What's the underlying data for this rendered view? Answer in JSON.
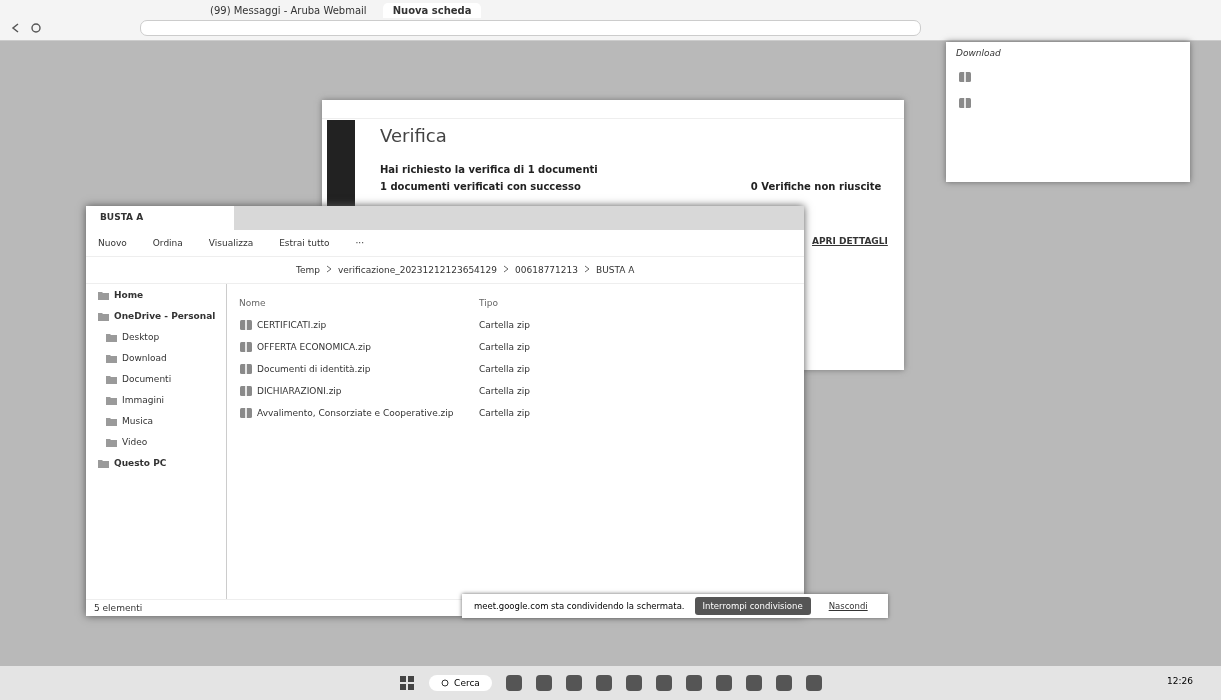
{
  "browser": {
    "tabs": [
      {
        "label": "(99) Messaggi - Aruba Webmail",
        "selected": false
      },
      {
        "label": "Nuova scheda",
        "selected": true
      }
    ]
  },
  "verifica": {
    "title": "Verifica",
    "heading": "Hai richiesto la verifica di 1 documenti",
    "success": "1 documenti verificati con successo",
    "failed": "0 Verifiche non riuscite",
    "details_button": "APRI DETTAGLI"
  },
  "explorer": {
    "tab": "BUSTA A",
    "toolbar": [
      "Nuovo",
      "Ordina",
      "Visualizza",
      "Estrai tutto",
      "···"
    ],
    "path": [
      "Temp",
      "verificazione_20231212123654129",
      "00618771213",
      "BUSTA A"
    ],
    "sidebar": [
      {
        "label": "Home",
        "kind": "top"
      },
      {
        "label": "OneDrive - Personal",
        "kind": "top"
      },
      {
        "label": "Desktop",
        "kind": "pin"
      },
      {
        "label": "Download",
        "kind": "pin"
      },
      {
        "label": "Documenti",
        "kind": "pin"
      },
      {
        "label": "Immagini",
        "kind": "pin"
      },
      {
        "label": "Musica",
        "kind": "pin"
      },
      {
        "label": "Video",
        "kind": "pin"
      },
      {
        "label": "Questo PC",
        "kind": "top"
      }
    ],
    "columns": [
      "Nome",
      "Tipo"
    ],
    "rows": [
      {
        "name": "CERTIFICATI.zip",
        "type": "Cartella zip"
      },
      {
        "name": "OFFERTA ECONOMICA.zip",
        "type": "Cartella zip"
      },
      {
        "name": "Documenti di identità.zip",
        "type": "Cartella zip"
      },
      {
        "name": "DICHIARAZIONI.zip",
        "type": "Cartella zip"
      },
      {
        "name": "Avvalimento, Consorziate e Cooperative.zip",
        "type": "Cartella zip"
      }
    ],
    "status": "5 elementi"
  },
  "downloads": {
    "title": "Download"
  },
  "share": {
    "message": "meet.google.com sta condividendo la schermata.",
    "stop": "Interrompi condivisione",
    "hide": "Nascondi"
  },
  "taskbar": {
    "search": "Cerca",
    "time": "12:26"
  }
}
